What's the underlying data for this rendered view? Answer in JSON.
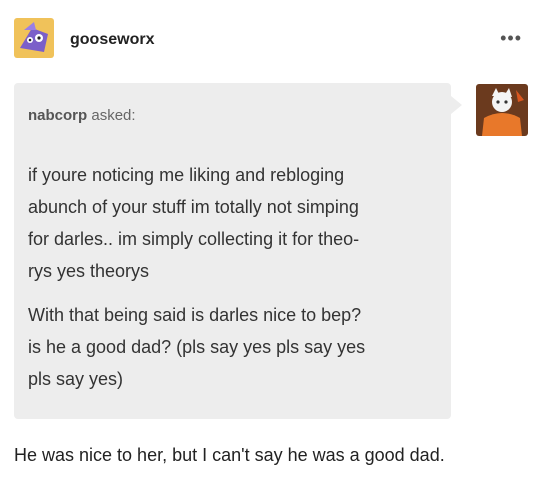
{
  "post": {
    "username": "gooseworx",
    "more_icon": "•••",
    "ask": {
      "asker": "nabcorp",
      "asked_label": "asked:",
      "paragraphs": [
        [
          "if youre noticing me liking and rebloging",
          "abunch of your stuff im totally not simping",
          "for darles.. im simply collecting it for theo-",
          "rys yes theorys"
        ],
        [
          "With that being said is darles nice to bep?",
          "is he a good dad? (pls say yes pls say yes",
          "pls say yes)"
        ]
      ]
    },
    "answer": "He was nice to her, but I can't say he was a good dad."
  },
  "colors": {
    "bubble": "#ededed",
    "avatar_main_bg": "#f0c25a",
    "avatar_main_figure": "#7b5fc9",
    "asker_avatar_bg": "#6b3a1e",
    "asker_avatar_figure": "#e8782a"
  },
  "icons": {
    "more": "more-horizontal-icon",
    "main_avatar": "purple-creature-avatar",
    "asker_avatar": "orange-character-avatar"
  }
}
